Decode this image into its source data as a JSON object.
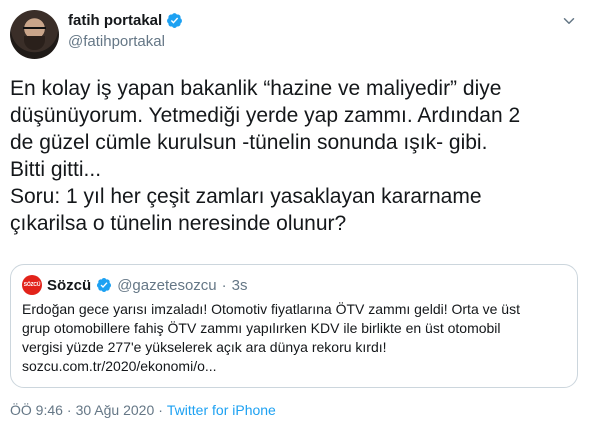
{
  "author": {
    "display_name": "fatih portakal",
    "handle": "@fatihportakal"
  },
  "tweet_text_lines": [
    "En kolay iş yapan  bakanlik “hazine ve maliyedir” diye",
    "düşünüyorum. Yetmediği yerde yap zammı. Ardından 2",
    "de güzel cümle kurulsun -tünelin sonunda ışık- gibi.",
    "Bitti gitti...",
    "Soru: 1 yıl her çeşit zamları yasaklayan kararname",
    "çıkarilsa o tünelin neresinde olunur?"
  ],
  "quote": {
    "logo_text": "SÖZCÜ",
    "display_name": "Sözcü",
    "handle": "@gazetesozcu",
    "separator": "·",
    "time": "3s",
    "body_lines": [
      "Erdoğan gece yarısı imzaladı! Otomotiv fiyatlarına ÖTV zammı geldi! Orta ve üst",
      "grup otomobillere fahiş ÖTV zammı yapılırken KDV ile birlikte en üst otomobil",
      "vergisi yüzde 277'e yükselerek açık ara dünya rekoru kırdı!",
      "sozcu.com.tr/2020/ekonomi/o..."
    ]
  },
  "meta": {
    "time": "ÖÖ 9:46",
    "separator1": "·",
    "date": "30 Ağu 2020",
    "separator2": "·",
    "source": "Twitter for iPhone"
  },
  "colors": {
    "verified": "#1da1f2",
    "secondary_text": "#657786",
    "link": "#1da1f2",
    "quote_border": "#ccd6dd",
    "sozcu_red": "#e2231a"
  },
  "icons": {
    "verified": "verified-badge-icon",
    "menu": "chevron-down-icon"
  }
}
